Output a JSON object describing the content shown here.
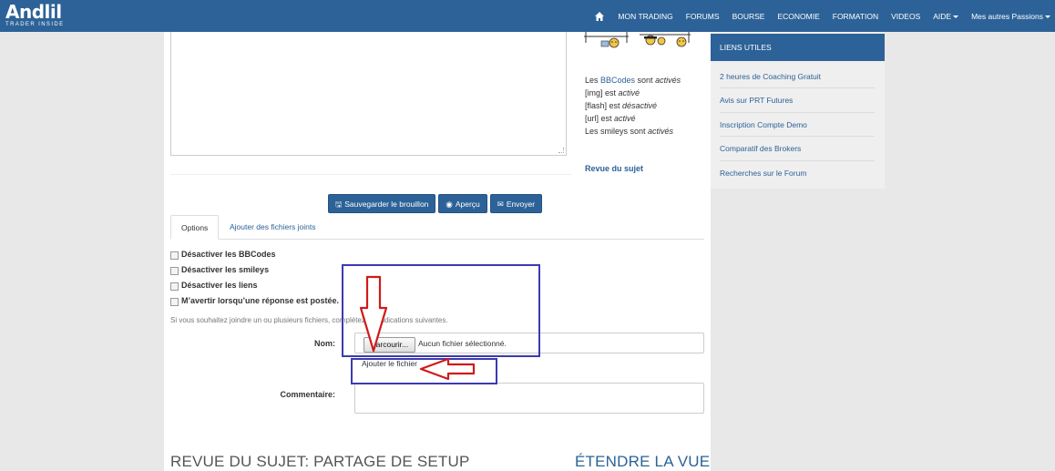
{
  "navbar": {
    "logo_title": "Andlil",
    "logo_sub": "TRADER INSIDE",
    "items": [
      "MON TRADING",
      "FORUMS",
      "BOURSE",
      "ECONOMIE",
      "FORMATION",
      "VIDEOS",
      "AIDE",
      "Mes autres Passions"
    ]
  },
  "bbcode_info": {
    "l1_a": "Les ",
    "l1_link": "BBCodes",
    "l1_b": " sont ",
    "l1_em": "activés",
    "l2_a": "[img] est ",
    "l2_em": "activé",
    "l3_a": "[flash] est ",
    "l3_em": "désactivé",
    "l4_a": "[url] est ",
    "l4_em": "activé",
    "l5_a": "Les smileys sont ",
    "l5_em": "activés"
  },
  "revue_link": "Revue du sujet",
  "buttons": {
    "save_draft": "Sauvegarder le brouillon",
    "preview": "Aperçu",
    "submit": "Envoyer"
  },
  "tabs": [
    "Options",
    "Ajouter des fichiers joints"
  ],
  "options": [
    "Désactiver les BBCodes",
    "Désactiver les smileys",
    "Désactiver les liens",
    "M’avertir lorsqu’une réponse est postée."
  ],
  "attach": {
    "help_text": "Si vous souhaitez joindre un ou plusieurs fichiers, complétez les indications suivantes.",
    "name_label": "Nom:",
    "browse_label": "Parcourir...",
    "no_file_text": "Aucun fichier sélectionné.",
    "add_file_label": "Ajouter le fichier",
    "comment_label": "Commentaire:"
  },
  "bottom": {
    "title": "REVUE DU SUJET: PARTAGE DE SETUP",
    "expand_link": "ÉTENDRE LA VUE"
  },
  "sidebar": {
    "title": "LIENS UTILES",
    "items": [
      "2 heures de Coaching Gratuit",
      "Avis sur PRT Futures",
      "Inscription Compte Demo",
      "Comparatif des Brokers",
      "Recherches sur le Forum"
    ]
  },
  "colors": {
    "brand_blue": "#2c6297",
    "annotation_blue": "#3b3bb0",
    "annotation_red": "#d01a1a"
  }
}
